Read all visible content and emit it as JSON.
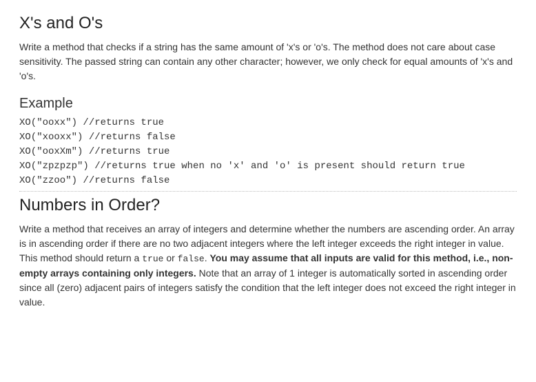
{
  "section1": {
    "title": "X's and O's",
    "description": "Write a method that checks if a string has the same amount of 'x's or 'o's. The method does not care about case sensitivity. The passed string can contain any other character; however, we only check for equal amounts of 'x's and 'o's.",
    "example_heading": "Example",
    "code": "XO(\"ooxx\") //returns true\nXO(\"xooxx\") //returns false\nXO(\"ooxXm\") //returns true\nXO(\"zpzpzp\") //returns true when no 'x' and 'o' is present should return true\nXO(\"zzoo\") //returns false"
  },
  "section2": {
    "title": "Numbers in Order?",
    "p_part1": "Write a method that receives an array of integers and determine whether the numbers are ascending order. An array is in ascending order if there are no two adjacent integers where the left integer exceeds the right integer in value. This method should return a ",
    "code_true": "true",
    "p_part2": " or ",
    "code_false": "false",
    "p_part3": ". ",
    "bold_text": "You may assume that all inputs are valid for this method, i.e., non-empty arrays containing only integers.",
    "p_part4": " Note that an array of 1 integer is automatically sorted in ascending order since all (zero) adjacent pairs of integers satisfy the condition that the left integer does not exceed the right integer in value."
  }
}
